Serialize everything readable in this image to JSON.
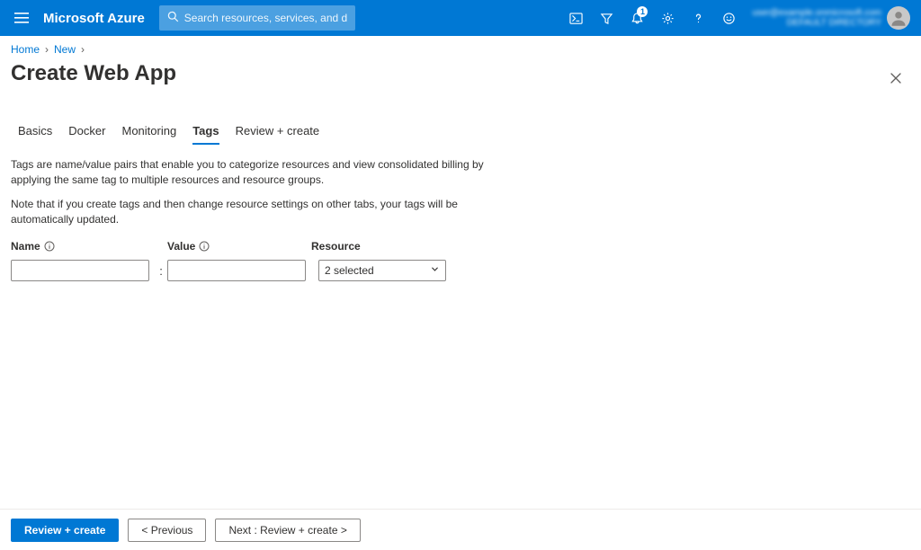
{
  "header": {
    "brand": "Microsoft Azure",
    "search_placeholder": "Search resources, services, and docs (G+/)",
    "notification_count": "1",
    "account_line1": "user@example.onmicrosoft.com",
    "account_line2": "DEFAULT DIRECTORY"
  },
  "breadcrumb": {
    "items": [
      "Home",
      "New"
    ]
  },
  "page": {
    "title": "Create Web App"
  },
  "tabs": {
    "items": [
      "Basics",
      "Docker",
      "Monitoring",
      "Tags",
      "Review + create"
    ],
    "active_index": 3
  },
  "description": {
    "p1": "Tags are name/value pairs that enable you to categorize resources and view consolidated billing by applying the same tag to multiple resources and resource groups.",
    "p2": "Note that if you create tags and then change resource settings on other tabs, your tags will be automatically updated."
  },
  "tag_form": {
    "headers": {
      "name": "Name",
      "value": "Value",
      "resource": "Resource"
    },
    "row": {
      "name_value": "",
      "value_value": "",
      "resource_selected": "2 selected"
    }
  },
  "footer": {
    "review_create": "Review + create",
    "previous": "< Previous",
    "next": "Next : Review + create >"
  }
}
